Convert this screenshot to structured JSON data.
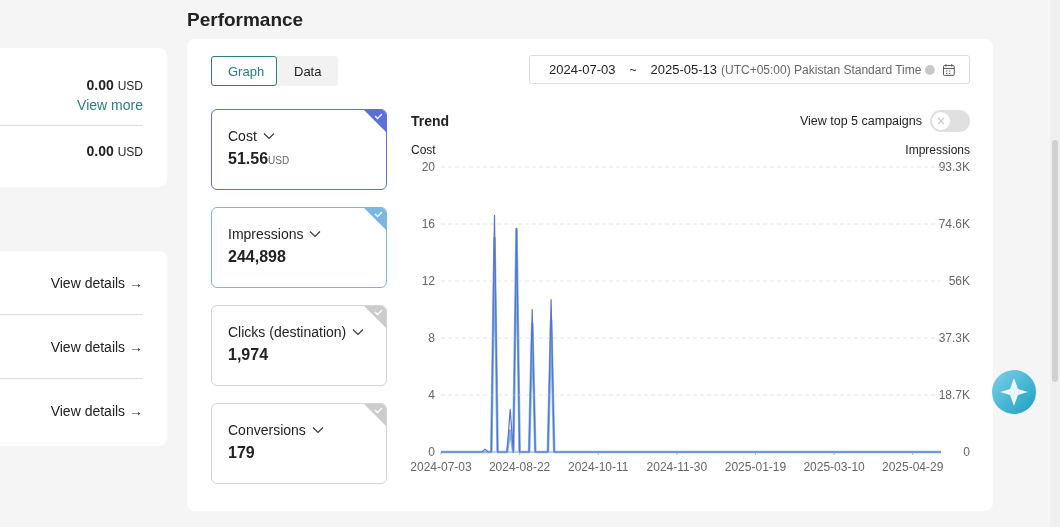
{
  "summary_card": {
    "rows": [
      {
        "value": "0.00",
        "unit": "USD",
        "link": "View more"
      },
      {
        "value": "0.00",
        "unit": "USD"
      }
    ]
  },
  "details_card": {
    "links": [
      "View details →",
      "View details →",
      "View details →"
    ]
  },
  "performance": {
    "title": "Performance",
    "tabs": [
      {
        "label": "Graph",
        "selected": true
      },
      {
        "label": "Data",
        "selected": false
      }
    ],
    "date_range": {
      "start": "2024-07-03",
      "separator": "~",
      "end": "2025-05-13",
      "timezone": "(UTC+05:00) Pakistan Standard Time"
    },
    "metrics": [
      {
        "label": "Cost",
        "value": "51.56",
        "unit": "USD",
        "selected": true,
        "color": "#5b6fd6"
      },
      {
        "label": "Impressions",
        "value": "244,898",
        "selected": true,
        "color": "#7ab8e0"
      },
      {
        "label": "Clicks (destination)",
        "value": "1,974",
        "selected": false
      },
      {
        "label": "Conversions",
        "value": "179",
        "selected": false
      }
    ],
    "trend": {
      "title": "Trend",
      "toggle": {
        "label": "View top 5 campaigns",
        "on": false
      },
      "chart_data": {
        "type": "line",
        "grid": true,
        "ylim": [
          0,
          20
        ],
        "yticks": [
          0,
          4,
          8,
          12,
          16,
          20
        ],
        "categories": [
          "2024-07-03",
          null,
          null,
          null,
          null,
          null,
          null,
          null,
          null,
          null,
          null,
          null,
          null,
          null,
          null,
          null,
          null,
          null,
          null,
          null,
          null,
          null,
          null,
          null,
          null,
          "2024-08-22",
          null,
          null,
          null,
          null,
          null,
          null,
          null,
          null,
          null,
          null,
          null,
          null,
          null,
          null,
          null,
          null,
          null,
          null,
          null,
          null,
          null,
          null,
          null,
          null,
          "2024-10-11",
          null,
          null,
          null,
          null,
          null,
          null,
          null,
          null,
          null,
          null,
          null,
          null,
          null,
          null,
          null,
          null,
          null,
          null,
          null,
          null,
          null,
          null,
          null,
          null,
          "2024-11-30",
          null,
          null,
          null,
          null,
          null,
          null,
          null,
          null,
          null,
          null,
          null,
          null,
          null,
          null,
          null,
          null,
          null,
          null,
          null,
          null,
          null,
          null,
          null,
          null,
          "2025-01-19",
          null,
          null,
          null,
          null,
          null,
          null,
          null,
          null,
          null,
          null,
          null,
          null,
          null,
          null,
          null,
          null,
          null,
          null,
          null,
          null,
          null,
          null,
          null,
          null,
          "2025-03-10",
          null,
          null,
          null,
          null,
          null,
          null,
          null,
          null,
          null,
          null,
          null,
          null,
          null,
          null,
          null,
          null,
          null,
          null,
          null,
          null,
          null,
          null,
          null,
          null,
          "2025-04-29",
          null,
          null,
          null,
          null,
          null,
          null,
          null,
          null,
          null
        ],
        "series": [
          {
            "name": "Cost",
            "color": "#5b6fd6",
            "values": [
              0,
              0,
              0,
              0,
              0,
              0,
              0,
              0,
              0,
              0,
              0,
              0,
              0,
              0,
              0.2,
              0,
              0,
              16.6,
              0,
              0,
              0,
              0,
              3,
              0,
              15.7,
              0,
              0,
              0,
              0,
              10,
              0,
              0,
              0,
              0,
              0,
              10.7,
              0,
              0,
              0,
              0,
              0,
              0,
              0,
              0,
              0,
              0,
              0,
              0,
              0,
              0,
              0,
              0,
              0,
              0,
              0,
              0,
              0,
              0,
              0,
              0,
              0,
              0,
              0,
              0,
              0,
              0,
              0,
              0,
              0,
              0,
              0,
              0,
              0,
              0,
              0,
              0,
              0,
              0,
              0,
              0,
              0,
              0,
              0,
              0,
              0,
              0,
              0,
              0,
              0,
              0,
              0,
              0,
              0,
              0,
              0,
              0,
              0,
              0,
              0,
              0,
              0,
              0,
              0,
              0,
              0,
              0,
              0,
              0,
              0,
              0,
              0,
              0,
              0,
              0,
              0,
              0,
              0,
              0,
              0,
              0,
              0,
              0,
              0,
              0,
              0,
              0,
              0,
              0,
              0,
              0,
              0,
              0,
              0,
              0,
              0,
              0,
              0,
              0,
              0,
              0,
              0,
              0,
              0,
              0,
              0,
              0,
              0,
              0,
              0,
              0,
              0,
              0,
              0,
              0,
              0,
              0,
              0,
              0,
              0,
              0
            ]
          }
        ]
      },
      "impressions_chart": {
        "chart_data": {
          "type": "line",
          "ylim": [
            0,
            93300
          ],
          "yticks": [
            {
              "value": 0,
              "label": "0"
            },
            {
              "value": 18700,
              "label": "18.7K"
            },
            {
              "value": 37300,
              "label": "37.3K"
            },
            {
              "value": 56000,
              "label": "56K"
            },
            {
              "value": 74600,
              "label": "74.6K"
            },
            {
              "value": 93300,
              "label": "93.3K"
            }
          ],
          "series": [
            {
              "name": "Impressions",
              "color": "#7ab8e0",
              "values": [
                0,
                0,
                0,
                0,
                0,
                0,
                0,
                0,
                0,
                0,
                0,
                0,
                0,
                0,
                0,
                0,
                0,
                70000,
                0,
                0,
                0,
                0,
                7000,
                0,
                73000,
                0,
                0,
                0,
                0,
                42000,
                0,
                0,
                0,
                0,
                0,
                43000,
                0,
                0,
                0,
                0,
                0,
                0,
                0,
                0,
                0,
                0,
                0,
                0,
                0,
                0,
                0,
                0,
                0,
                0,
                0,
                0,
                0,
                0,
                0,
                0,
                0,
                0,
                0,
                0,
                0,
                0,
                0,
                0,
                0,
                0,
                0,
                0,
                0,
                0,
                0,
                0,
                0,
                0,
                0,
                0,
                0,
                0,
                0,
                0,
                0,
                0,
                0,
                0,
                0,
                0,
                0,
                0,
                0,
                0,
                0,
                0,
                0,
                0,
                0,
                0,
                0,
                0,
                0,
                0,
                0,
                0,
                0,
                0,
                0,
                0,
                0,
                0,
                0,
                0,
                0,
                0,
                0,
                0,
                0,
                0,
                0,
                0,
                0,
                0,
                0,
                0,
                0,
                0,
                0,
                0,
                0,
                0,
                0,
                0,
                0,
                0,
                0,
                0,
                0,
                0,
                0,
                0,
                0,
                0,
                0,
                0,
                0,
                0,
                0,
                0,
                0,
                0,
                0,
                0,
                0,
                0,
                0,
                0,
                0,
                0
              ]
            }
          ]
        }
      }
    }
  }
}
